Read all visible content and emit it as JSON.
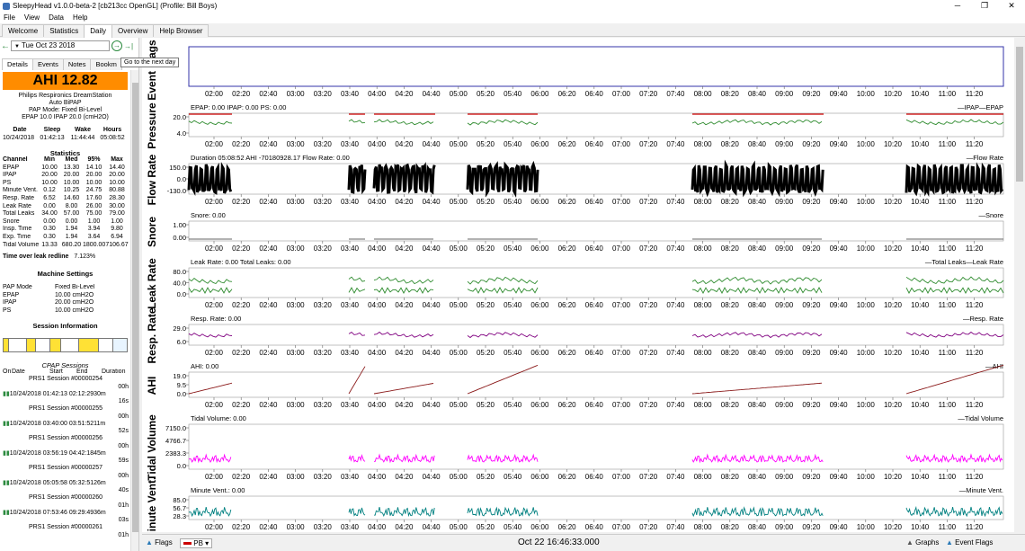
{
  "window": {
    "title": "SleepyHead v1.0.0-beta-2 [cb213cc OpenGL] (Profile: Bill Boys)"
  },
  "menu": [
    "File",
    "View",
    "Data",
    "Help"
  ],
  "tabs": [
    "Welcome",
    "Statistics",
    "Daily",
    "Overview",
    "Help Browser"
  ],
  "active_tab": "Daily",
  "nav": {
    "date": "Tue Oct 23 2018",
    "tooltip": "Go to the next day"
  },
  "subtabs": [
    "Details",
    "Events",
    "Notes",
    "Bookm"
  ],
  "ahi_label": "AHI 12.82",
  "machine": {
    "name": "Philips Respironics DreamStation",
    "model": "Auto BiPAP",
    "mode": "PAP Mode: Fixed Bi-Level",
    "pressure": "EPAP 10.0 IPAP 20.0 (cmH2O)"
  },
  "summary": {
    "headers": [
      "Date",
      "Sleep",
      "Wake",
      "Hours"
    ],
    "values": [
      "10/24/2018",
      "01:42:13",
      "11:44:44",
      "05:08:52"
    ]
  },
  "statistics": {
    "title": "Statistics",
    "headers": [
      "Channel",
      "Min",
      "Med",
      "95%",
      "Max"
    ],
    "rows": [
      [
        "EPAP",
        "10.00",
        "13.30",
        "14.10",
        "14.40"
      ],
      [
        "IPAP",
        "20.00",
        "20.00",
        "20.00",
        "20.00"
      ],
      [
        "PS",
        "10.00",
        "10.00",
        "10.00",
        "10.00"
      ],
      [
        "Minute Vent.",
        "0.12",
        "10.25",
        "24.75",
        "80.88"
      ],
      [
        "Resp. Rate",
        "6.52",
        "14.60",
        "17.60",
        "28.30"
      ],
      [
        "Leak Rate",
        "0.00",
        "8.00",
        "26.00",
        "30.00"
      ],
      [
        "Total Leaks",
        "34.00",
        "57.00",
        "75.00",
        "79.00"
      ],
      [
        "Snore",
        "0.00",
        "0.00",
        "1.00",
        "1.00"
      ],
      [
        "Insp. Time",
        "0.30",
        "1.94",
        "3.94",
        "9.80"
      ],
      [
        "Exp. Time",
        "0.30",
        "1.94",
        "3.64",
        "6.94"
      ],
      [
        "Tidal Volume",
        "13.33",
        "680.20",
        "1800.00",
        "7106.67"
      ]
    ]
  },
  "leak_redline": {
    "label": "Time over leak redline",
    "value": "7.123%"
  },
  "machine_settings": {
    "title": "Machine Settings",
    "rows": [
      [
        "PAP Mode",
        "Fixed Bi-Level"
      ],
      [
        "EPAP",
        "10.00 cmH2O"
      ],
      [
        "IPAP",
        "20.00 cmH2O"
      ],
      [
        "PS",
        "10.00 cmH2O"
      ]
    ]
  },
  "session_info": {
    "title": "Session Information",
    "cpap_title": "CPAP Sessions",
    "headers": [
      "On",
      "Date",
      "Start",
      "End",
      "Duration"
    ],
    "sessions": [
      {
        "name": "PRS1 Session #00000254",
        "row": "10/24/2018 01:42:13 02:12:29",
        "dur1": "00h",
        "dur2": "30m",
        "dur3": "16s"
      },
      {
        "name": "PRS1 Session #00000255",
        "row": "10/24/2018 03:40:00 03:51:52",
        "dur1": "00h",
        "dur2": "11m",
        "dur3": "52s"
      },
      {
        "name": "PRS1 Session #00000256",
        "row": "10/24/2018 03:56:19 04:42:18",
        "dur1": "00h",
        "dur2": "45m",
        "dur3": "59s"
      },
      {
        "name": "PRS1 Session #00000257",
        "row": "10/24/2018 05:05:58 05:32:51",
        "dur1": "00h",
        "dur2": "26m",
        "dur3": "40s"
      },
      {
        "name": "PRS1 Session #00000260",
        "row": "10/24/2018 07:53:46 09:29:49",
        "dur1": "01h",
        "dur2": "36m",
        "dur3": "03s"
      },
      {
        "name": "PRS1 Session #00000261",
        "row": "",
        "dur1": "01h",
        "dur2": "",
        "dur3": ""
      }
    ]
  },
  "graphs": {
    "time_ticks": [
      "02:00",
      "02:20",
      "02:40",
      "03:00",
      "03:20",
      "03:40",
      "04:00",
      "04:20",
      "04:40",
      "05:00",
      "05:20",
      "05:40",
      "06:00",
      "06:20",
      "06:40",
      "07:00",
      "07:20",
      "07:40",
      "08:00",
      "08:20",
      "08:40",
      "09:00",
      "09:20",
      "09:40",
      "10:00",
      "10:20",
      "10:40",
      "11:00",
      "11:20"
    ],
    "panels": [
      {
        "id": "event-flags",
        "ylabel": "Event Flags",
        "caption": "",
        "legend": "",
        "yticks": []
      },
      {
        "id": "pressure",
        "ylabel": "Pressure",
        "caption": "EPAP: 0.00 IPAP: 0.00 PS: 0.00",
        "legend": "IPAP—EPAP",
        "yticks": [
          "20.0",
          "4.0"
        ]
      },
      {
        "id": "flow-rate",
        "ylabel": "Flow Rate",
        "caption": "Duration 05:08:52 AHI -70180928.17 Flow Rate: 0.00",
        "legend": "Flow Rate",
        "yticks": [
          "150.0",
          "0.0",
          "-130.0"
        ]
      },
      {
        "id": "snore",
        "ylabel": "Snore",
        "caption": "Snore: 0.00",
        "legend": "Snore",
        "yticks": [
          "1.00",
          "0.00"
        ]
      },
      {
        "id": "leak-rate",
        "ylabel": "Leak Rate",
        "caption": "Leak Rate: 0.00 Total Leaks: 0.00",
        "legend": "Total Leaks—Leak Rate",
        "yticks": [
          "80.0",
          "40.0",
          "0.0"
        ]
      },
      {
        "id": "resp-rate",
        "ylabel": "Resp. Rate",
        "caption": "Resp. Rate: 0.00",
        "legend": "Resp. Rate",
        "yticks": [
          "29.0",
          "6.0"
        ]
      },
      {
        "id": "ahi",
        "ylabel": "AHI",
        "caption": "AHI: 0.00",
        "legend": "AHI",
        "yticks": [
          "19.0",
          "9.5",
          "0.0"
        ]
      },
      {
        "id": "tidal-volume",
        "ylabel": "Tidal Volume",
        "caption": "Tidal Volume: 0.00",
        "legend": "Tidal Volume",
        "yticks": [
          "7150.0",
          "4766.7",
          "2383.3",
          "0.0"
        ]
      },
      {
        "id": "minute-vent",
        "ylabel": "Minute Vent.",
        "caption": "Minute Vent.: 0.00",
        "legend": "Minute Vent.",
        "yticks": [
          "85.0",
          "56.7",
          "28.3"
        ]
      }
    ]
  },
  "statusbar": {
    "flags": "Flags",
    "pb": "PB",
    "time": "Oct 22 16:46:33.000",
    "graphs": "Graphs",
    "event_flags": "Event Flags"
  },
  "colors": {
    "ahi_box": "#ff8c00",
    "ipap": "#cc0000",
    "epap": "#2e8b2e",
    "flow": "#000000",
    "leak": "#2e8b2e",
    "resp": "#800080",
    "ahi_line": "#8b1a1a",
    "tidal": "#ff00ff",
    "minvent": "#008080"
  }
}
